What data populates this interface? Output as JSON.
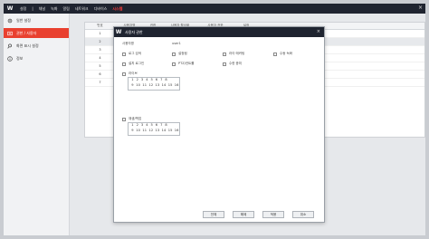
{
  "topbar": {
    "logo": "W",
    "menu": [
      "설정",
      "|",
      "채널",
      "녹화",
      "알림",
      "네트워크",
      "디바이스",
      "시스템"
    ],
    "close": "×"
  },
  "sidebar": {
    "items": [
      {
        "label": "일반 설정",
        "icon": "gear-icon"
      },
      {
        "label": "권한 / 사용자",
        "icon": "user-icon"
      },
      {
        "label": "화면 표시 설정",
        "icon": "pin-icon"
      },
      {
        "label": "정보",
        "icon": "info-icon"
      }
    ]
  },
  "table": {
    "headers": [
      "번호",
      "사용자명",
      "권한",
      "사용자 활성화",
      "사용자 권한",
      "설정"
    ],
    "rows": [
      "1",
      "2",
      "3",
      "4",
      "5",
      "6",
      "7"
    ]
  },
  "modal": {
    "logo": "W",
    "title": "사용자 권한",
    "close": "×",
    "user_label": "사용자명",
    "user_value": "user1",
    "perm_row1": [
      "로그 검색",
      "설정됨",
      "라이 매커팅",
      "수동 녹화"
    ],
    "perm_row2": [
      "설치 로그인",
      "PTZ/컨트롤",
      "수한 종미"
    ],
    "group1_label": "라이브",
    "group2_label": "재생/백업",
    "channels_line1": [
      "1",
      "2",
      "3",
      "4",
      "5",
      "6",
      "7",
      "8"
    ],
    "channels_line2": [
      "9",
      "10",
      "11",
      "12",
      "13",
      "14",
      "15",
      "16"
    ],
    "buttons": [
      "전체",
      "해제",
      "적용",
      "취소"
    ]
  }
}
